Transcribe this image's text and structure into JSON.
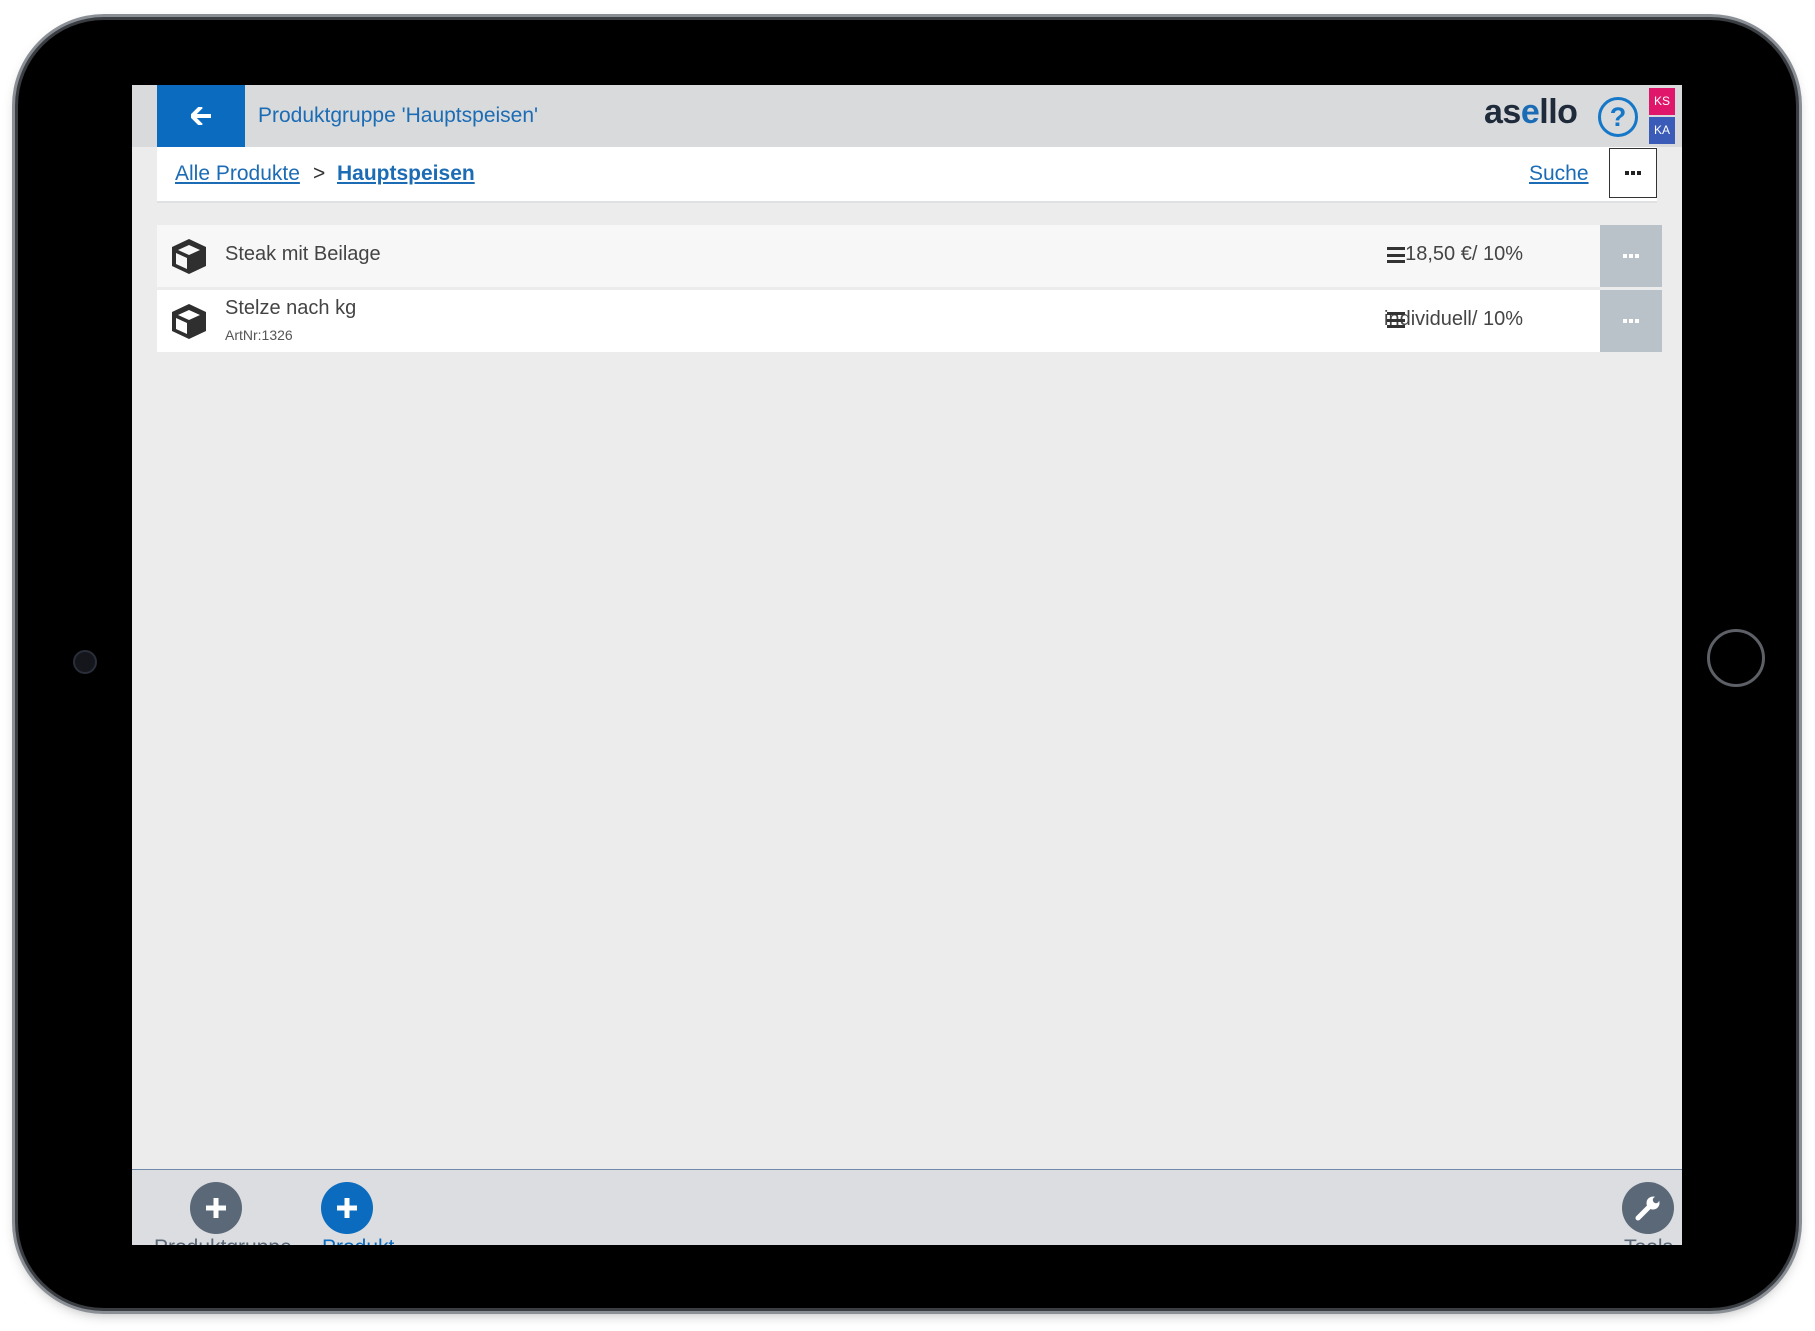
{
  "header": {
    "title": "Produktgruppe 'Hauptspeisen'",
    "logo_text_1": "as",
    "logo_text_accent": "e",
    "logo_text_2": "llo",
    "help_label": "?",
    "badge_ks": "KS",
    "badge_ka": "KA"
  },
  "breadcrumb": {
    "all_products": "Alle Produkte",
    "separator": ">",
    "current": "Hauptspeisen",
    "search_label": "Suche"
  },
  "products": [
    {
      "name": "Steak mit Beilage",
      "artnr": "",
      "price": "18,50 €/ 10%"
    },
    {
      "name": "Stelze nach kg",
      "artnr": "ArtNr:1326",
      "price": "individuell/ 10%"
    }
  ],
  "footer": {
    "add_group_label": "Produktgruppe",
    "add_product_label": "Produkt",
    "tools_label": "Tools"
  },
  "colors": {
    "primary": "#0a6bbf",
    "link": "#1c6cb5",
    "badge_ks": "#e0166b",
    "badge_ka": "#3a5bb8",
    "fab_gray": "#5a6878"
  },
  "icons": {
    "back": "arrow-left-icon",
    "help": "question-circle-icon",
    "product": "box-icon",
    "list": "list-icon",
    "more": "more-dots-icon",
    "add": "plus-icon",
    "tools": "wrench-icon"
  }
}
